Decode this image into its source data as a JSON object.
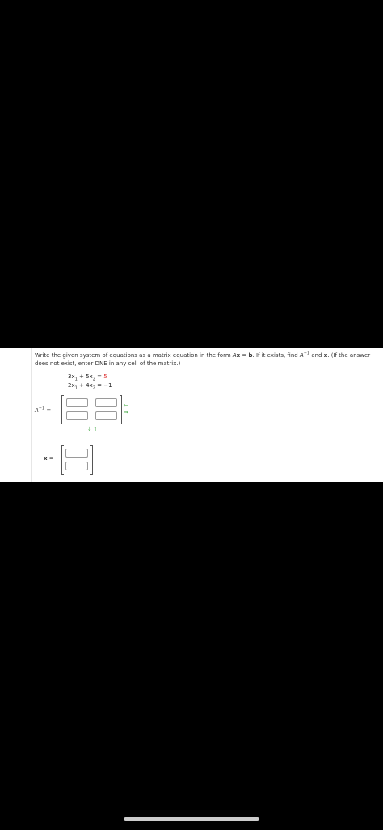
{
  "question": {
    "part1": "Write the given system of equations as a matrix equation in the form ",
    "A": "A",
    "x": "x",
    "eq": " = ",
    "b": "b",
    "part2": ". If it exists, find ",
    "Ainv_base": "A",
    "Ainv_sup": "−1",
    "part3": " and ",
    "x2": "x",
    "part4": ". (If the answer does not exist, enter DNE in any cell of the matrix.)"
  },
  "equations": [
    {
      "text_a": "3x",
      "sub_a": "1",
      "text_b": " + 5x",
      "sub_b": "2",
      "text_c": " = ",
      "rhs": "5",
      "rhs_red": true
    },
    {
      "text_a": "2x",
      "sub_a": "1",
      "text_b": " + 4x",
      "sub_b": "2",
      "text_c": " = ",
      "rhs": "−1",
      "rhs_red": false
    }
  ],
  "ainv_label": {
    "base": "A",
    "sup": "−1",
    "eq": " ="
  },
  "x_label": {
    "var": "x",
    "eq": " ="
  },
  "controls": {
    "add_col": "⇒",
    "remove_col": "⇐",
    "add_row": "⇓",
    "remove_row": "⇑"
  }
}
